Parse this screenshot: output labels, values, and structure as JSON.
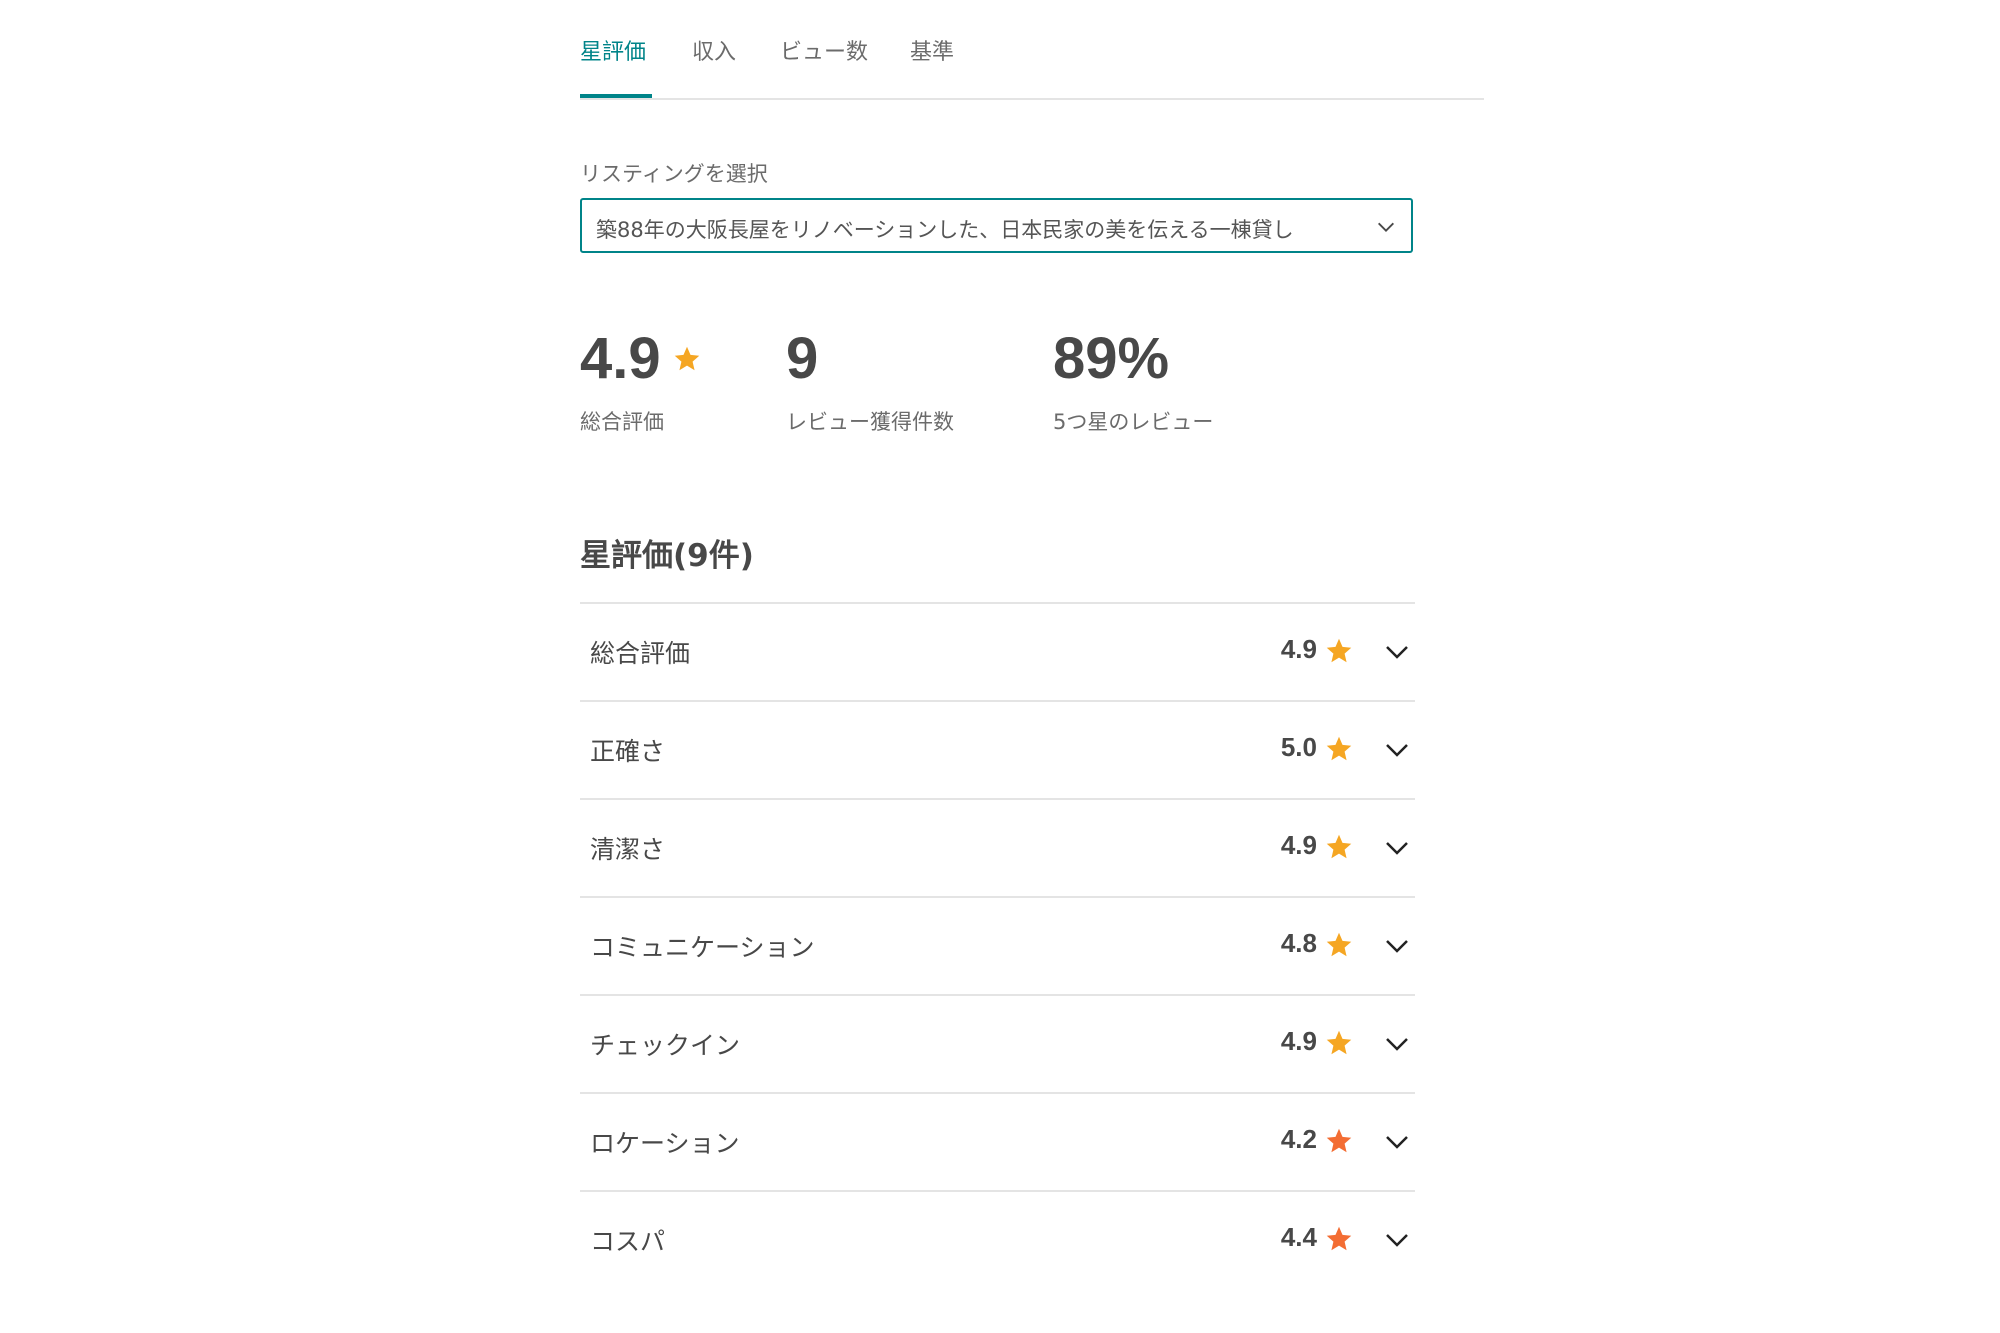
{
  "tabs": [
    {
      "label": "星評価",
      "active": true
    },
    {
      "label": "収入",
      "active": false
    },
    {
      "label": "ビュー数",
      "active": false
    },
    {
      "label": "基準",
      "active": false
    }
  ],
  "listing_select": {
    "label": "リスティングを選択",
    "value": "築88年の大阪長屋をリノベーションした、日本民家の美を伝える一棟貸し"
  },
  "summary": {
    "overall": {
      "value": "4.9",
      "label": "総合評価"
    },
    "reviews": {
      "value": "9",
      "label": "レビュー獲得件数"
    },
    "five_star": {
      "value": "89%",
      "label": "5つ星のレビュー"
    }
  },
  "section": {
    "title": "星評価(9件)"
  },
  "ratings": [
    {
      "name": "総合評価",
      "score": "4.9",
      "star_color": "#f5a623"
    },
    {
      "name": "正確さ",
      "score": "5.0",
      "star_color": "#f5a623"
    },
    {
      "name": "清潔さ",
      "score": "4.9",
      "star_color": "#f5a623"
    },
    {
      "name": "コミュニケーション",
      "score": "4.8",
      "star_color": "#f5a623"
    },
    {
      "name": "チェックイン",
      "score": "4.9",
      "star_color": "#f5a623"
    },
    {
      "name": "ロケーション",
      "score": "4.2",
      "star_color": "#f36d33"
    },
    {
      "name": "コスパ",
      "score": "4.4",
      "star_color": "#f36d33"
    }
  ],
  "colors": {
    "accent": "#008489",
    "star_high": "#f5a623",
    "star_low": "#f36d33",
    "text": "#484848",
    "divider": "#e4e4e4"
  }
}
